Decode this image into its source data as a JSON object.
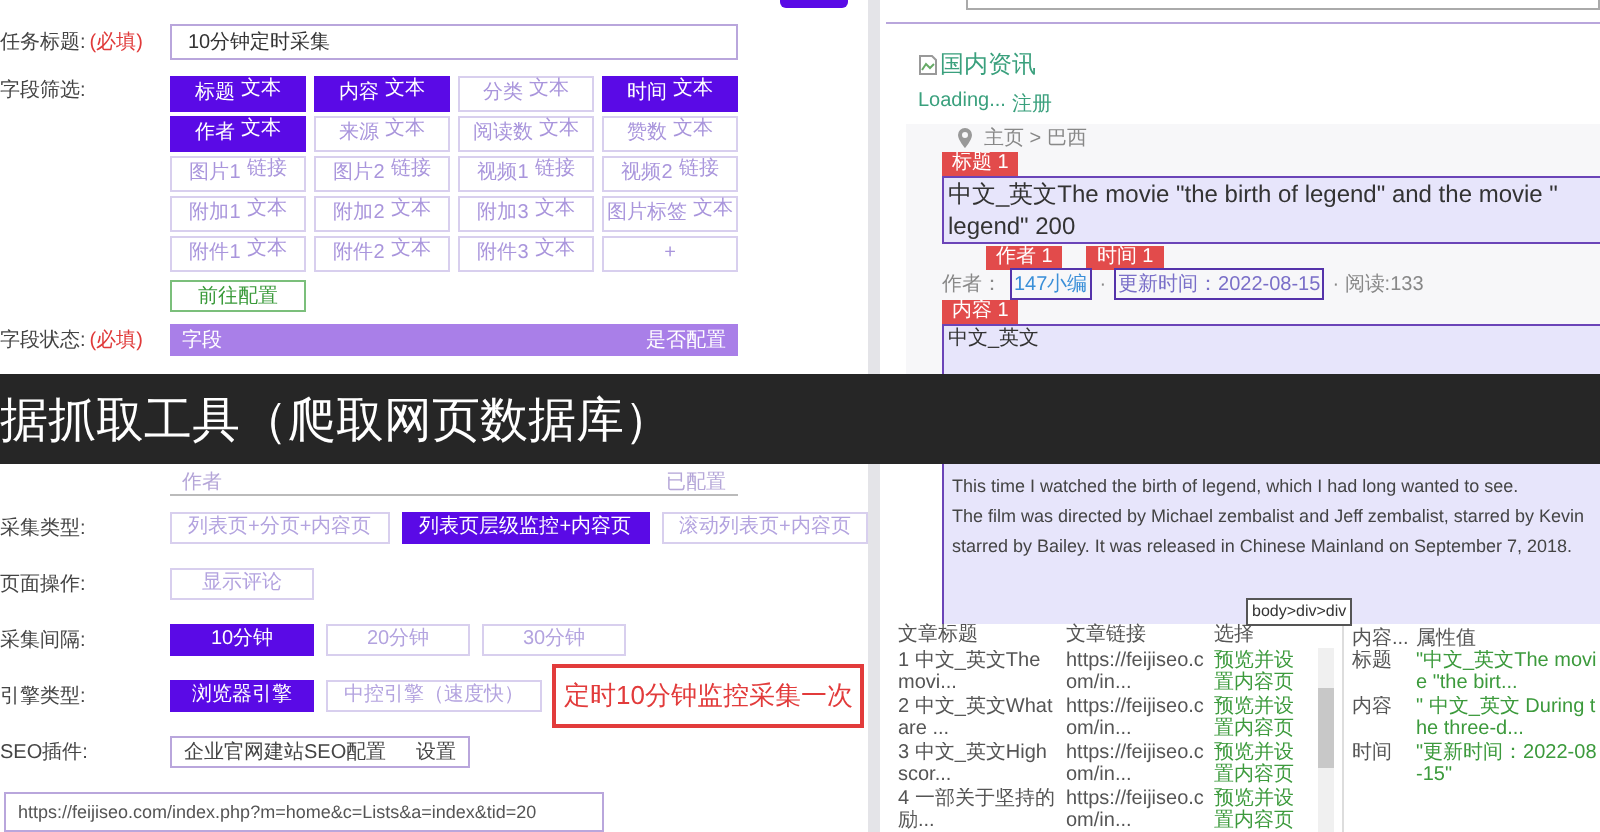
{
  "task_title": {
    "label": "任务标题:",
    "required": "(必填)",
    "value": "10分钟定时采集"
  },
  "field_filter": {
    "label": "字段筛选:",
    "fields": [
      {
        "name": "标题",
        "type": "文本",
        "selected": true
      },
      {
        "name": "内容",
        "type": "文本",
        "selected": true
      },
      {
        "name": "分类",
        "type": "文本",
        "selected": false
      },
      {
        "name": "时间",
        "type": "文本",
        "selected": true
      },
      {
        "name": "作者",
        "type": "文本",
        "selected": true
      },
      {
        "name": "来源",
        "type": "文本",
        "selected": false
      },
      {
        "name": "阅读数",
        "type": "文本",
        "selected": false
      },
      {
        "name": "赞数",
        "type": "文本",
        "selected": false
      },
      {
        "name": "图片1",
        "type": "链接",
        "selected": false
      },
      {
        "name": "图片2",
        "type": "链接",
        "selected": false
      },
      {
        "name": "视频1",
        "type": "链接",
        "selected": false
      },
      {
        "name": "视频2",
        "type": "链接",
        "selected": false
      },
      {
        "name": "附加1",
        "type": "文本",
        "selected": false
      },
      {
        "name": "附加2",
        "type": "文本",
        "selected": false
      },
      {
        "name": "附加3",
        "type": "文本",
        "selected": false
      },
      {
        "name": "图片标签",
        "type": "文本",
        "selected": false
      },
      {
        "name": "附件1",
        "type": "文本",
        "selected": false
      },
      {
        "name": "附件2",
        "type": "文本",
        "selected": false
      },
      {
        "name": "附件3",
        "type": "文本",
        "selected": false
      }
    ],
    "add": "+",
    "config_button": "前往配置"
  },
  "field_status": {
    "label": "字段状态:",
    "required": "(必填)",
    "columns": [
      "字段",
      "是否配置"
    ]
  },
  "banner": "据抓取工具（爬取网页数据库）",
  "field_status_rows": [
    {
      "field": "作者",
      "status": "已配置"
    }
  ],
  "option_groups": [
    {
      "label": "采集类型:",
      "options": [
        {
          "label": "列表页+分页+内容页",
          "selected": false
        },
        {
          "label": "列表页层级监控+内容页",
          "selected": true
        },
        {
          "label": "滚动列表页+内容页",
          "selected": false
        }
      ]
    },
    {
      "label": "页面操作:",
      "options": [
        {
          "label": "显示评论",
          "selected": false
        }
      ]
    },
    {
      "label": "采集间隔:",
      "options": [
        {
          "label": "10分钟",
          "selected": true
        },
        {
          "label": "20分钟",
          "selected": false
        },
        {
          "label": "30分钟",
          "selected": false
        }
      ]
    },
    {
      "label": "引擎类型:",
      "options": [
        {
          "label": "浏览器引擎",
          "selected": true
        },
        {
          "label": "中控引擎（速度快）",
          "selected": false
        }
      ]
    }
  ],
  "seo": {
    "label": "SEO插件:",
    "value": "企业官网建站SEO配置",
    "button": "设置"
  },
  "url": "https://feijiseo.com/index.php?m=home&c=Lists&a=index&tid=20",
  "annotation": "定时10分钟监控采集一次",
  "preview": {
    "image_alt": "国内资讯",
    "loading": "Loading...",
    "register": "注册",
    "breadcrumb": "主页 > 巴西",
    "title_tag": "标题 1",
    "title_lines": [
      "中文_英文The movie \"the birth of legend\" and the movie \"",
      "legend\" 200"
    ],
    "author_tag": "作者 1",
    "time_tag": "时间 1",
    "author_label": "作者：",
    "author": "147小编",
    "separator": "·",
    "time": "更新时间：2022-08-15",
    "reads": "· 阅读:133",
    "content_tag": "内容 1",
    "content_first": "中文_英文",
    "content_rest": [
      "This time I watched the birth of legend, which I had long wanted to see.",
      "The film was directed by Michael zembalist and Jeff zembalist, starred by Kevin",
      "starred by Bailey. It was released in Chinese Mainland on September 7, 2018."
    ]
  },
  "articles": {
    "columns": [
      "文章标题",
      "文章链接",
      "选择"
    ],
    "tooltip": "body>div>div",
    "rows": [
      {
        "title": "1 中文_英文The movi...",
        "link": "https://feijiseo.com/in...",
        "action": "预览并设置内容页"
      },
      {
        "title": "2 中文_英文What are ...",
        "link": "https://feijiseo.com/in...",
        "action": "预览并设置内容页"
      },
      {
        "title": "3 中文_英文High scor...",
        "link": "https://feijiseo.com/in...",
        "action": "预览并设置内容页"
      },
      {
        "title": "4 一部关于坚持的励...",
        "link": "https://feijiseo.com/in...",
        "action": "预览并设置内容页"
      }
    ]
  },
  "attributes": {
    "columns": [
      "内容...",
      "属性值"
    ],
    "rows": [
      {
        "name": "标题",
        "value": "\"中文_英文The movie \"the birt..."
      },
      {
        "name": "内容",
        "value": "\" 中文_英文 During the three-d..."
      },
      {
        "name": "时间",
        "value": "\"更新时间：2022-08-15\""
      }
    ]
  }
}
